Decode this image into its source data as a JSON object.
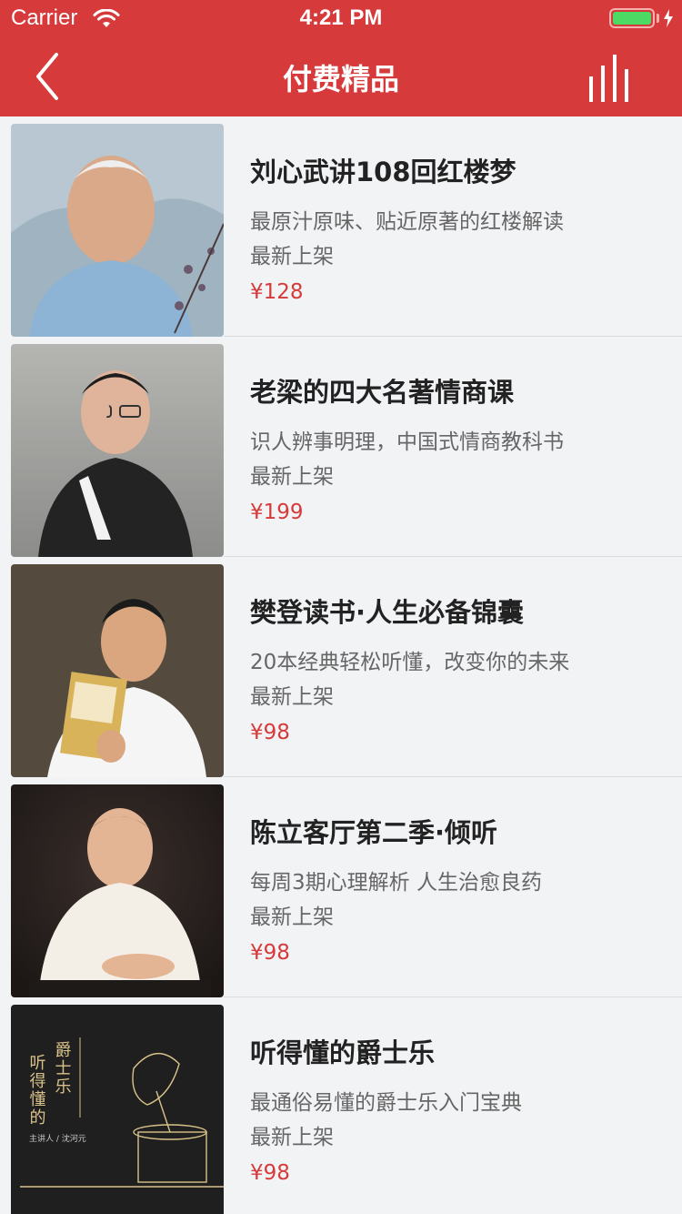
{
  "status_bar": {
    "carrier": "Carrier",
    "time": "4:21 PM",
    "battery_level": 1.0
  },
  "nav": {
    "title": "付费精品",
    "back_icon": "chevron-left-icon",
    "player_icon": "audio-bars-icon"
  },
  "colors": {
    "brand_red": "#d63a3a",
    "price_red": "#d63a3a",
    "background": "#f2f3f5"
  },
  "items": [
    {
      "title": "刘心武讲108回红楼梦",
      "description": "最原汁原味、贴近原著的红楼解读",
      "tag": "最新上架",
      "price": "¥128"
    },
    {
      "title": "老梁的四大名著情商课",
      "description": "识人辨事明理，中国式情商教科书",
      "tag": "最新上架",
      "price": "¥199"
    },
    {
      "title": "樊登读书·人生必备锦囊",
      "description": "20本经典轻松听懂，改变你的未来",
      "tag": "最新上架",
      "price": "¥98"
    },
    {
      "title": "陈立客厅第二季·倾听",
      "description": "每周3期心理解析 人生治愈良药",
      "tag": "最新上架",
      "price": "¥98"
    },
    {
      "title": "听得懂的爵士乐",
      "description": "最通俗易懂的爵士乐入门宝典",
      "tag": "最新上架",
      "price": "¥98",
      "cover_text": {
        "col1": "听得懂的",
        "col2": "爵士乐",
        "credit": "主讲人 / 沈河元"
      }
    }
  ]
}
